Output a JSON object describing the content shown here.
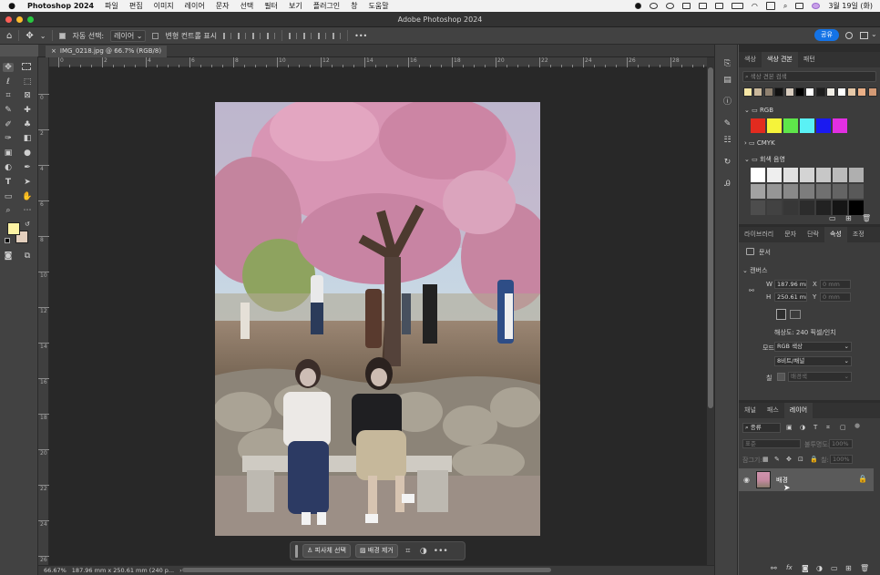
{
  "menubar": {
    "app": "Photoshop 2024",
    "items": [
      "파일",
      "편집",
      "이미지",
      "레이어",
      "문자",
      "선택",
      "필터",
      "보기",
      "플러그인",
      "창",
      "도움말"
    ],
    "datetime": "3월 19일 (화)"
  },
  "window": {
    "title": "Adobe Photoshop 2024"
  },
  "options": {
    "auto_select_label": "자동 선택:",
    "auto_select_value": "레이어",
    "transform_label": "변형 컨트롤 표시",
    "share_label": "공유",
    "more": "•••"
  },
  "document": {
    "tab_close": "×",
    "tab_title": "IMG_0218.jpg @ 66.7% (RGB/8)"
  },
  "ruler": {
    "h": [
      "0",
      "2",
      "4",
      "6",
      "8",
      "10",
      "12",
      "14",
      "16",
      "18",
      "20",
      "22",
      "24",
      "26",
      "28"
    ],
    "v": [
      "0",
      "2",
      "4",
      "6",
      "8",
      "10",
      "12",
      "14",
      "16",
      "18",
      "20",
      "22",
      "24",
      "26"
    ]
  },
  "status": {
    "zoom": "66.67%",
    "info": "187.96 mm x 250.61 mm (240 p...",
    "arrow": "›"
  },
  "context_bar": {
    "subject": "피사체 선택",
    "remove_bg": "배경 제거",
    "more": "•••"
  },
  "swatches": {
    "tabs": [
      "색상",
      "색상 견본",
      "패턴"
    ],
    "search_placeholder": "색상 견본 검색",
    "recent": [
      "#f7e7a6",
      "#c9b79b",
      "#8f8170",
      "#111111",
      "#d9cdbf",
      "#000000",
      "#ffffff",
      "#1d1d1d",
      "#f1eee6",
      "#ffffff",
      "#e6c8a8",
      "#ebb087",
      "#d39a75"
    ],
    "groups": [
      "RGB",
      "CMYK",
      "회색 음영"
    ],
    "rgb": [
      "#e22b1f",
      "#f5f33a",
      "#5ee64a",
      "#5af1f5",
      "#1a1af0",
      "#e22fe2"
    ],
    "grays": [
      "#ffffff",
      "#eeeeee",
      "#e1e1e1",
      "#d4d4d4",
      "#c7c7c7",
      "#bbbbbb",
      "#afafaf",
      "#a2a2a2",
      "#969696",
      "#898989",
      "#7d7d7d",
      "#707070",
      "#646464",
      "#595959",
      "#4d4d4d",
      "#424242",
      "#373737",
      "#2c2c2c",
      "#222222",
      "#151515",
      "#000000"
    ]
  },
  "properties": {
    "tabs": [
      "라이브러리",
      "문자",
      "단락",
      "속성",
      "조정"
    ],
    "doc_label": "문서",
    "canvas_label": "캔버스",
    "w_label": "W",
    "w": "187.96 mm",
    "x_label": "X",
    "x_ph": "0 mm",
    "h_label": "H",
    "h": "250.61 mm",
    "y_label": "Y",
    "y_ph": "0 mm",
    "resolution": "해상도: 240 픽셀/인치",
    "mode_label": "모드",
    "mode": "RGB 색상",
    "depth": "8비트/채널",
    "fill_label": "칠",
    "fill": "배경색"
  },
  "layers": {
    "tabs": [
      "채널",
      "패스",
      "레이어"
    ],
    "kind": "종류",
    "blend": "표준",
    "opacity_label": "불투명도:",
    "opacity": "100%",
    "lock_label": "잠그기:",
    "fill_label": "칠:",
    "fill": "100%",
    "layer_name": "배경"
  },
  "colors": {
    "fg": "#fdf3a3",
    "bg": "#e3cfbd",
    "accent": "#1473e6"
  }
}
